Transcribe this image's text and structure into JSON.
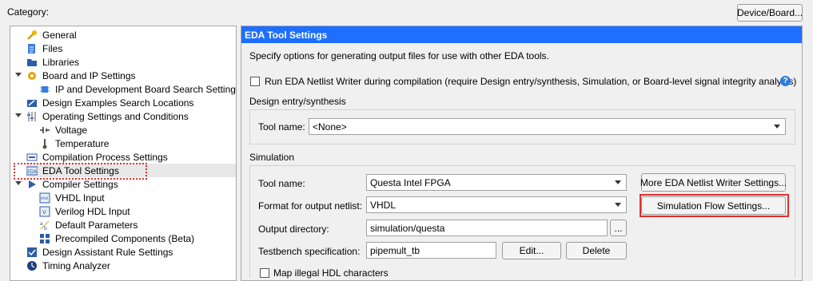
{
  "header": {
    "category_label": "Category:",
    "device_button": "Device/Board..."
  },
  "tree": {
    "items": [
      {
        "label": "General"
      },
      {
        "label": "Files"
      },
      {
        "label": "Libraries"
      },
      {
        "label": "Board and IP Settings"
      },
      {
        "label": "IP and Development Board Search Settings"
      },
      {
        "label": "Design Examples Search Locations"
      },
      {
        "label": "Operating Settings and Conditions"
      },
      {
        "label": "Voltage"
      },
      {
        "label": "Temperature"
      },
      {
        "label": "Compilation Process Settings"
      },
      {
        "label": "EDA Tool Settings"
      },
      {
        "label": "Compiler Settings"
      },
      {
        "label": "VHDL Input"
      },
      {
        "label": "Verilog HDL Input"
      },
      {
        "label": "Default Parameters"
      },
      {
        "label": "Precompiled Components (Beta)"
      },
      {
        "label": "Design Assistant Rule Settings"
      },
      {
        "label": "Timing Analyzer"
      }
    ]
  },
  "panel": {
    "title": "EDA Tool Settings",
    "description": "Specify options for generating output files for use with other EDA tools.",
    "netlist_writer_checkbox": "Run EDA Netlist Writer during compilation (require Design entry/synthesis, Simulation, or Board-level signal integrity analysis)",
    "design_entry": {
      "group_label": "Design entry/synthesis",
      "tool_name_label": "Tool name:",
      "tool_name_value": "<None>"
    },
    "simulation": {
      "group_label": "Simulation",
      "tool_name_label": "Tool name:",
      "tool_name_value": "Questa Intel FPGA",
      "format_label": "Format for output netlist:",
      "format_value": "VHDL",
      "output_dir_label": "Output directory:",
      "output_dir_value": "simulation/questa",
      "browse_label": "...",
      "testbench_label": "Testbench specification:",
      "testbench_value": "pipemult_tb",
      "edit_button": "Edit...",
      "delete_button": "Delete",
      "more_settings_button": "More EDA Netlist Writer Settings...",
      "flow_settings_button": "Simulation Flow Settings...",
      "map_illegal_checkbox": "Map illegal HDL characters"
    }
  },
  "colors": {
    "panel_header": "#1e6fff",
    "highlight_red": "#e03030"
  }
}
